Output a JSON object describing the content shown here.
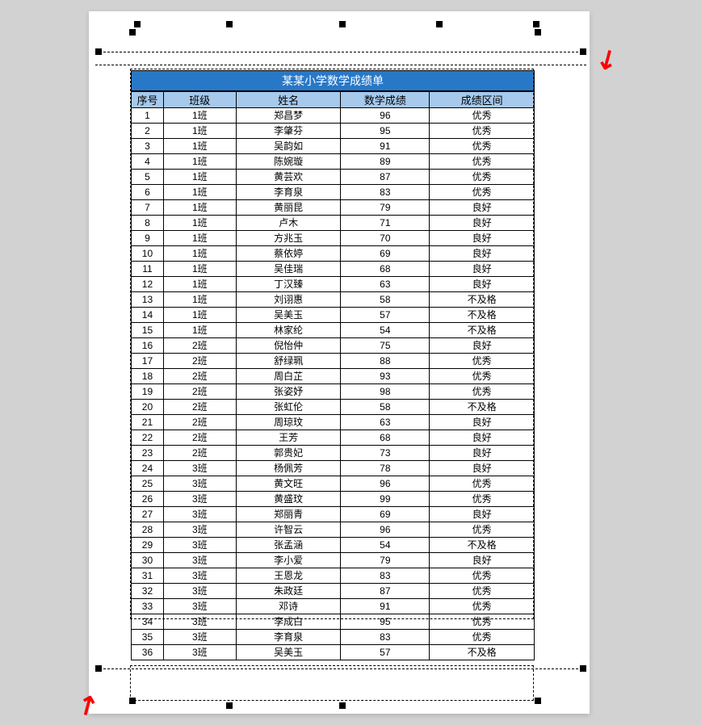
{
  "title": "某某小学数学成绩单",
  "columns": [
    "序号",
    "班级",
    "姓名",
    "数学成绩",
    "成绩区间"
  ],
  "rows": [
    {
      "no": 1,
      "class": "1班",
      "name": "郑昌梦",
      "score": 96,
      "band": "优秀"
    },
    {
      "no": 2,
      "class": "1班",
      "name": "李肇芬",
      "score": 95,
      "band": "优秀"
    },
    {
      "no": 3,
      "class": "1班",
      "name": "吴韵如",
      "score": 91,
      "band": "优秀"
    },
    {
      "no": 4,
      "class": "1班",
      "name": "陈婉璇",
      "score": 89,
      "band": "优秀"
    },
    {
      "no": 5,
      "class": "1班",
      "name": "黄芸欢",
      "score": 87,
      "band": "优秀"
    },
    {
      "no": 6,
      "class": "1班",
      "name": "李育泉",
      "score": 83,
      "band": "优秀"
    },
    {
      "no": 7,
      "class": "1班",
      "name": "黄丽昆",
      "score": 79,
      "band": "良好"
    },
    {
      "no": 8,
      "class": "1班",
      "name": "卢木",
      "score": 71,
      "band": "良好"
    },
    {
      "no": 9,
      "class": "1班",
      "name": "方兆玉",
      "score": 70,
      "band": "良好"
    },
    {
      "no": 10,
      "class": "1班",
      "name": "蔡依婷",
      "score": 69,
      "band": "良好"
    },
    {
      "no": 11,
      "class": "1班",
      "name": "吴佳瑞",
      "score": 68,
      "band": "良好"
    },
    {
      "no": 12,
      "class": "1班",
      "name": "丁汉臻",
      "score": 63,
      "band": "良好"
    },
    {
      "no": 13,
      "class": "1班",
      "name": "刘诩惠",
      "score": 58,
      "band": "不及格"
    },
    {
      "no": 14,
      "class": "1班",
      "name": "吴美玉",
      "score": 57,
      "band": "不及格"
    },
    {
      "no": 15,
      "class": "1班",
      "name": "林家纶",
      "score": 54,
      "band": "不及格"
    },
    {
      "no": 16,
      "class": "2班",
      "name": "倪怡仲",
      "score": 75,
      "band": "良好"
    },
    {
      "no": 17,
      "class": "2班",
      "name": "舒绿珮",
      "score": 88,
      "band": "优秀"
    },
    {
      "no": 18,
      "class": "2班",
      "name": "周白芷",
      "score": 93,
      "band": "优秀"
    },
    {
      "no": 19,
      "class": "2班",
      "name": "张姿妤",
      "score": 98,
      "band": "优秀"
    },
    {
      "no": 20,
      "class": "2班",
      "name": "张虹伦",
      "score": 58,
      "band": "不及格"
    },
    {
      "no": 21,
      "class": "2班",
      "name": "周琼玟",
      "score": 63,
      "band": "良好"
    },
    {
      "no": 22,
      "class": "2班",
      "name": "王芳",
      "score": 68,
      "band": "良好"
    },
    {
      "no": 23,
      "class": "2班",
      "name": "郭贵妃",
      "score": 73,
      "band": "良好"
    },
    {
      "no": 24,
      "class": "3班",
      "name": "杨佩芳",
      "score": 78,
      "band": "良好"
    },
    {
      "no": 25,
      "class": "3班",
      "name": "黄文旺",
      "score": 96,
      "band": "优秀"
    },
    {
      "no": 26,
      "class": "3班",
      "name": "黄盛玟",
      "score": 99,
      "band": "优秀"
    },
    {
      "no": 27,
      "class": "3班",
      "name": "郑丽青",
      "score": 69,
      "band": "良好"
    },
    {
      "no": 28,
      "class": "3班",
      "name": "许智云",
      "score": 96,
      "band": "优秀"
    },
    {
      "no": 29,
      "class": "3班",
      "name": "张孟涵",
      "score": 54,
      "band": "不及格"
    },
    {
      "no": 30,
      "class": "3班",
      "name": "李小爱",
      "score": 79,
      "band": "良好"
    },
    {
      "no": 31,
      "class": "3班",
      "name": "王恩龙",
      "score": 83,
      "band": "优秀"
    },
    {
      "no": 32,
      "class": "3班",
      "name": "朱政廷",
      "score": 87,
      "band": "优秀"
    },
    {
      "no": 33,
      "class": "3班",
      "name": "邓诗",
      "score": 91,
      "band": "优秀"
    },
    {
      "no": 34,
      "class": "3班",
      "name": "李成白",
      "score": 95,
      "band": "优秀"
    },
    {
      "no": 35,
      "class": "3班",
      "name": "李育泉",
      "score": 83,
      "band": "优秀"
    },
    {
      "no": 36,
      "class": "3班",
      "name": "吴美玉",
      "score": 57,
      "band": "不及格"
    }
  ]
}
